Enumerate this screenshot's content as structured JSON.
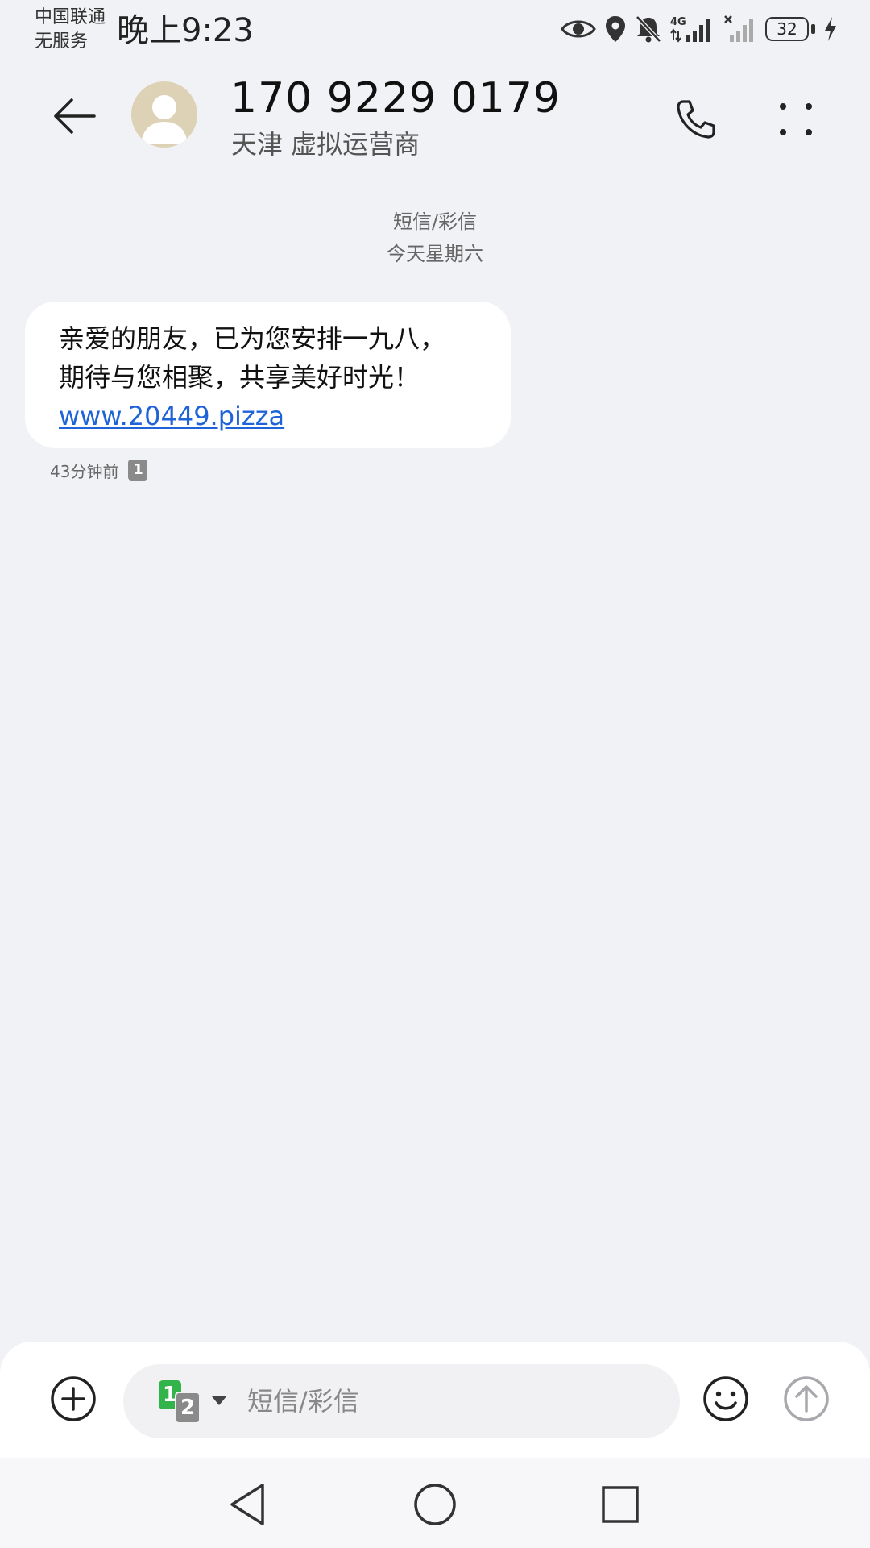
{
  "status_bar": {
    "carrier_line1": "中国联通",
    "carrier_line2": "无服务",
    "time": "晚上9:23",
    "battery_level": "32",
    "network_type": "4G",
    "icons": [
      "eye-icon",
      "location-icon",
      "bell-off-icon",
      "signal-4g-icon",
      "signal-no-service-icon",
      "battery-icon",
      "charging-icon"
    ]
  },
  "header": {
    "contact_number": "170 9229 0179",
    "contact_location": "天津 虚拟运营商",
    "icons": [
      "back-arrow-icon",
      "avatar-person-icon",
      "phone-icon",
      "more-dots-icon"
    ]
  },
  "conversation": {
    "message_type": "短信/彩信",
    "date_label": "今天星期六",
    "messages": [
      {
        "line1": "亲爱的朋友，已为您安排一九八，",
        "line2": "期待与您相聚，共享美好时光！",
        "link": "www.20449.pizza",
        "time_ago": "43分钟前",
        "sim_slot": "1"
      }
    ]
  },
  "composer": {
    "placeholder": "短信/彩信",
    "sim_primary": "1",
    "sim_secondary": "2",
    "icons": [
      "add-circle-icon",
      "sim-switch-icon",
      "emoji-icon",
      "send-arrow-icon"
    ]
  },
  "navbar": {
    "icons": [
      "nav-back-triangle-icon",
      "nav-home-circle-icon",
      "nav-recents-square-icon"
    ]
  },
  "colors": {
    "background": "#f1f2f5",
    "bubble": "#ffffff",
    "link": "#1f63d8",
    "sim1": "#33b44a",
    "sim2": "#8a8a8a",
    "avatar": "#ddd2b6"
  }
}
